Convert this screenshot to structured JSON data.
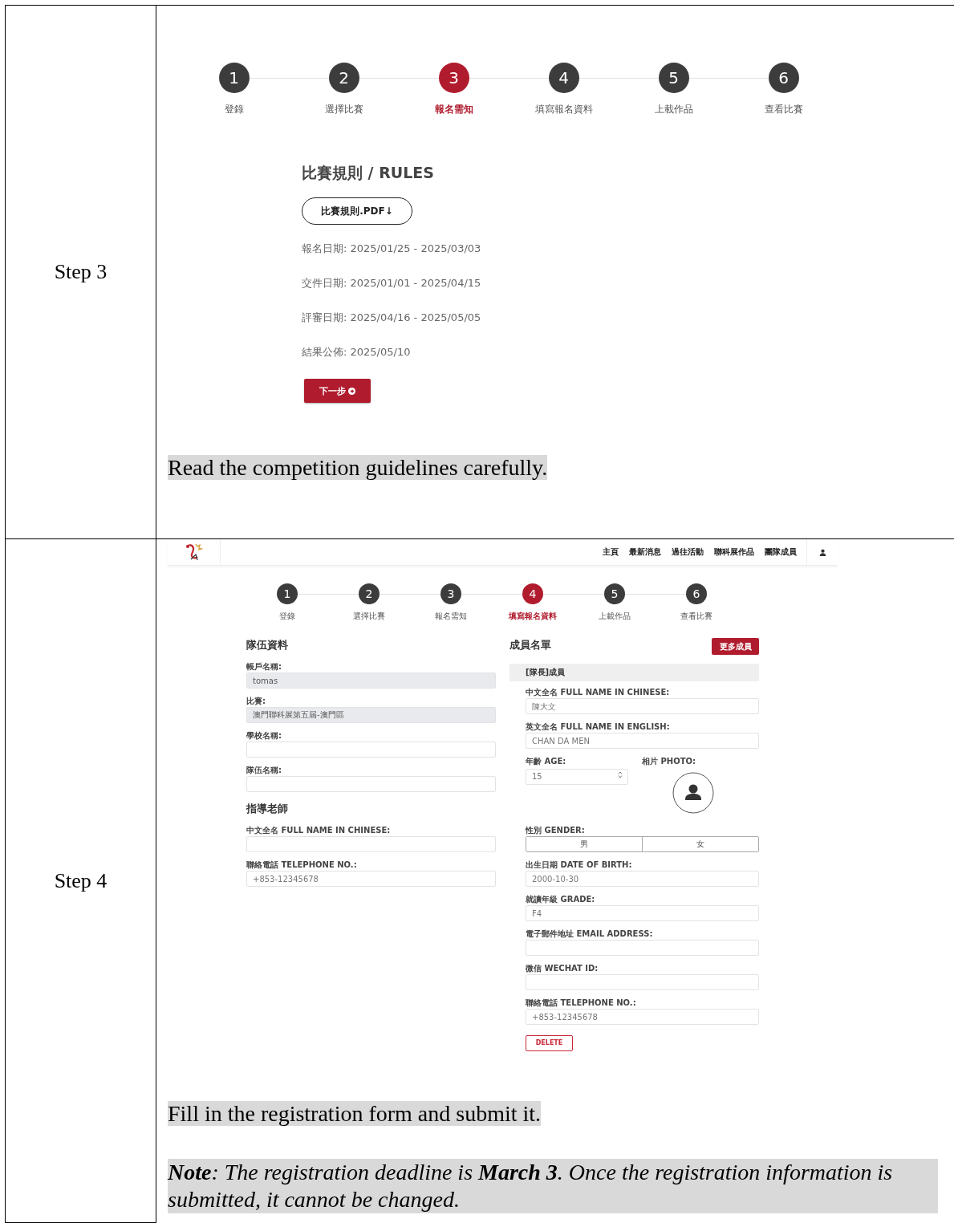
{
  "step3": {
    "label": "Step 3",
    "steps": [
      {
        "number": "1",
        "label": "登錄",
        "selected": false
      },
      {
        "number": "2",
        "label": "選擇比賽",
        "selected": false
      },
      {
        "number": "3",
        "label": "報名需知",
        "selected": true
      },
      {
        "number": "4",
        "label": "填寫報名資料",
        "selected": false
      },
      {
        "number": "5",
        "label": "上載作品",
        "selected": false
      },
      {
        "number": "6",
        "label": "查看比賽",
        "selected": false
      }
    ],
    "rules_title": "比賽規則 / RULES",
    "pdf_button": "比賽規則.PDF↓",
    "dates": [
      "報名日期: 2025/01/25 - 2025/03/03",
      "交件日期: 2025/01/01 - 2025/04/15",
      "評審日期: 2025/04/16 - 2025/05/05",
      "結果公佈: 2025/05/10"
    ],
    "next_button": "下一步",
    "caption": "Read the competition guidelines carefully."
  },
  "step4": {
    "label": "Step 4",
    "nav": [
      "主頁",
      "最新消息",
      "過往活動",
      "聯科展作品",
      "團隊成員"
    ],
    "steps": [
      {
        "number": "1",
        "label": "登錄",
        "selected": false
      },
      {
        "number": "2",
        "label": "選擇比賽",
        "selected": false
      },
      {
        "number": "3",
        "label": "報名需知",
        "selected": false
      },
      {
        "number": "4",
        "label": "填寫報名資料",
        "selected": true
      },
      {
        "number": "5",
        "label": "上載作品",
        "selected": false
      },
      {
        "number": "6",
        "label": "查看比賽",
        "selected": false
      }
    ],
    "team": {
      "title": "隊伍資料",
      "fields": [
        {
          "label": "帳戶名稱:",
          "value": "tomas",
          "disabled": true
        },
        {
          "label": "比賽:",
          "value": "澳門聯科展第五屆-澳門區",
          "disabled": true
        },
        {
          "label": "學校名稱:",
          "disabled": false
        },
        {
          "label": "隊伍名稱:",
          "disabled": false
        }
      ]
    },
    "teacher": {
      "title": "指導老師",
      "fields": [
        {
          "label": "中文全名 FULL NAME IN CHINESE:"
        },
        {
          "label": "聯絡電話 TELEPHONE NO.:",
          "placeholder": "+853-12345678"
        }
      ]
    },
    "members": {
      "title": "成員名單",
      "more_button": "更多成員",
      "member_header": "[隊長]成員",
      "fields": [
        {
          "label": "中文全名 FULL NAME IN CHINESE:",
          "placeholder": "陳大文"
        },
        {
          "label": "英文全名 FULL NAME IN ENGLISH:",
          "placeholder": "CHAN DA MEN"
        }
      ],
      "age_label": "年齡 AGE:",
      "age_placeholder": "15",
      "photo_label": "相片 PHOTO:",
      "gender_label": "性別 GENDER:",
      "gender_options": [
        "男",
        "女"
      ],
      "more_fields": [
        {
          "label": "出生日期 DATE OF BIRTH:",
          "placeholder": "2000-10-30"
        },
        {
          "label": "就讀年級 GRADE:",
          "placeholder": "F4"
        },
        {
          "label": "電子郵件地址 EMAIL ADDRESS:"
        },
        {
          "label": "微信 WECHAT ID:"
        },
        {
          "label": "聯絡電話 TELEPHONE NO.:",
          "placeholder": "+853-12345678"
        }
      ],
      "delete_button": "DELETE"
    },
    "caption": "Fill in the registration form and submit it.",
    "note": "**Note**: The registration deadline is **March 3**. Once the registration information is submitted, it cannot be changed."
  }
}
